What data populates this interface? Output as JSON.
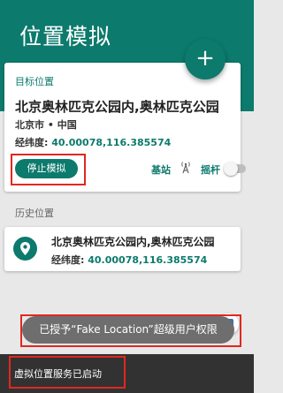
{
  "header": {
    "title": "位置模拟",
    "add_button": "+"
  },
  "target": {
    "label": "目标位置",
    "place": "北京奥林匹克公园内,奥林匹克公园",
    "city": "北京市 • 中国",
    "coord_label": "经纬度:",
    "coord_value": "40.00078,116.385574",
    "stop_button": "停止模拟",
    "base_station_label": "基站",
    "joystick_label": "摇杆",
    "joystick_enabled": false
  },
  "history": {
    "title": "历史位置",
    "items": [
      {
        "place": "北京奥林匹克公园内,奥林匹克公园",
        "coord_label": "经纬度:",
        "coord_value": "40.00078,116.385574"
      }
    ]
  },
  "toast": {
    "text": "已授予“Fake Location”超级用户权限"
  },
  "snackbar": {
    "text": "虚拟位置服务已启动"
  },
  "colors": {
    "primary": "#0c7a6c",
    "highlight": "#e0281f"
  },
  "icons": {
    "fab": "plus-icon",
    "base_station": "signal-tower-icon",
    "history_item": "location-pin-icon",
    "side": "app-icon"
  }
}
